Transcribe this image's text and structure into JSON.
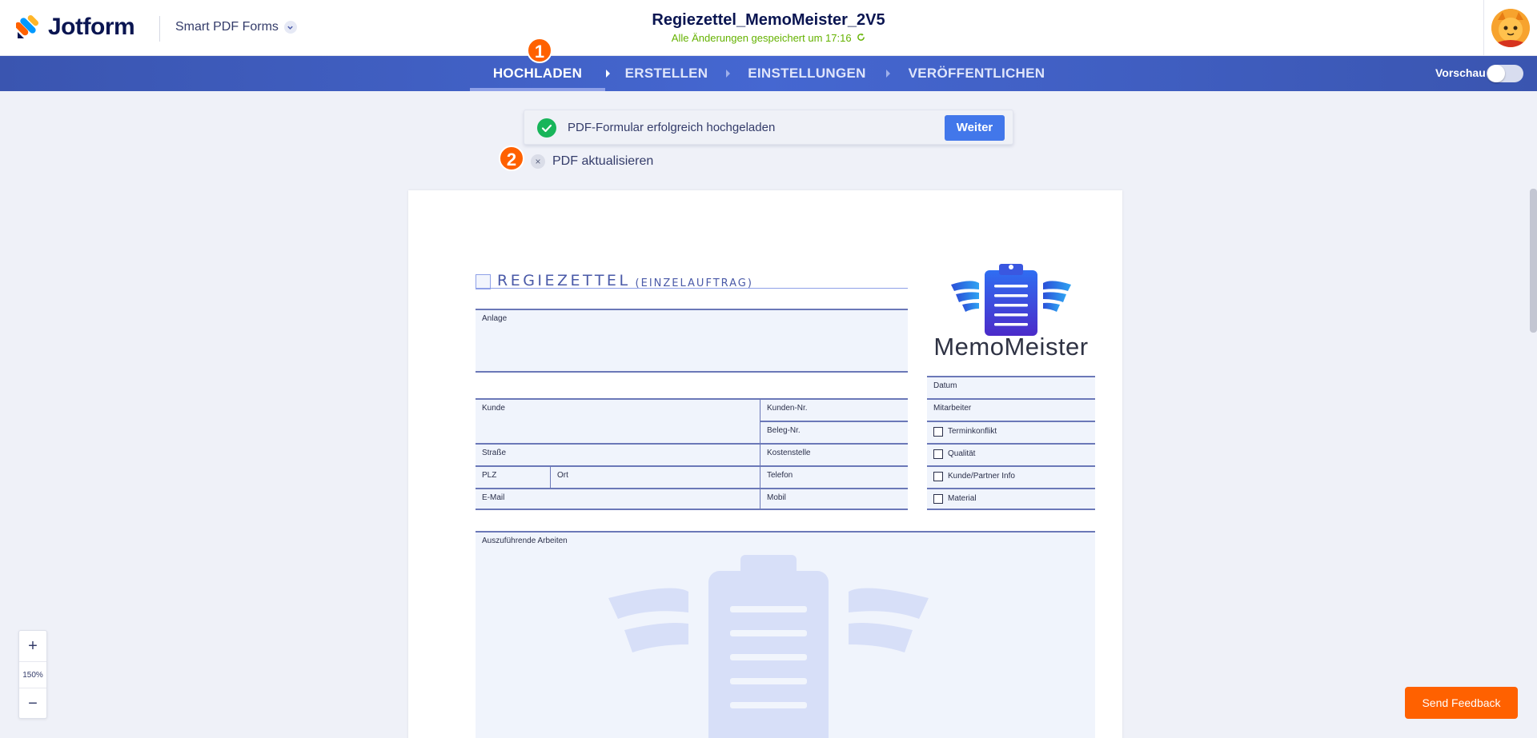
{
  "header": {
    "brand": "Jotform",
    "product": "Smart PDF Forms",
    "doc_title": "Regiezettel_MemoMeister_2V5",
    "save_status": "Alle Änderungen gespeichert um 17:16",
    "icons": {
      "logo": "jotform-logo-icon",
      "dropdown": "chevron-down-icon",
      "refresh": "refresh-icon",
      "avatar": "user-avatar"
    }
  },
  "nav": {
    "steps": [
      "HOCHLADEN",
      "ERSTELLEN",
      "EINSTELLUNGEN",
      "VERÖFFENTLICHEN"
    ],
    "active_index": 0,
    "preview_label": "Vorschau",
    "preview_enabled": false
  },
  "badges": {
    "step1": "1",
    "step2": "2"
  },
  "banner": {
    "message": "PDF-Formular erfolgreich hochgeladen",
    "button": "Weiter",
    "update_label": "PDF aktualisieren",
    "close_glyph": "×"
  },
  "document": {
    "title_main": "REGIEZETTEL",
    "title_sub": "(EINZELAUFTRAG)",
    "brand_name": "MemoMeister",
    "fields": {
      "anlage": "Anlage",
      "kunde": "Kunde",
      "kunden_nr": "Kunden-Nr.",
      "beleg_nr": "Beleg-Nr.",
      "strasse": "Straße",
      "kostenstelle": "Kostenstelle",
      "plz": "PLZ",
      "ort": "Ort",
      "telefon": "Telefon",
      "email": "E-Mail",
      "mobil": "Mobil",
      "datum": "Datum",
      "mitarbeiter": "Mitarbeiter",
      "arbeiten": "Auszuführende Arbeiten"
    },
    "checkboxes": [
      "Terminkonflikt",
      "Qualität",
      "Kunde/Partner Info",
      "Material"
    ]
  },
  "zoom": {
    "plus": "+",
    "level": "150%",
    "minus": "−"
  },
  "feedback": "Send Feedback",
  "colors": {
    "accent": "#ff6100",
    "nav": "#3a55b0",
    "success": "#18b55a",
    "primary_button": "#4277ea"
  }
}
